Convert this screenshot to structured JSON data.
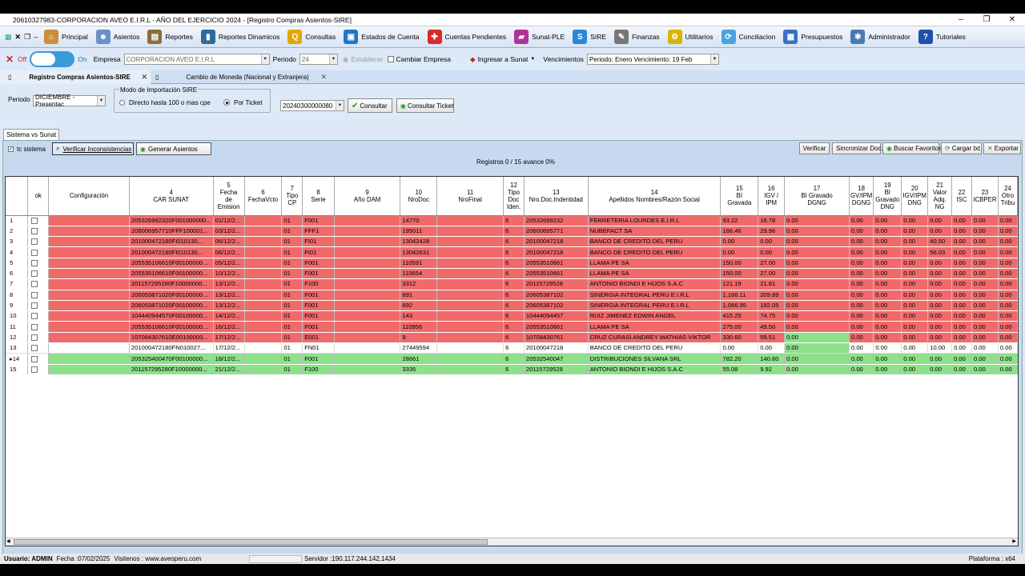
{
  "window": {
    "title": "20610327983-CORPORACION AVEO E.I.R.L  -  AÑO DEL EJERCICIO 2024 - [Registro Compras Asientos-SIRE]",
    "min": "–",
    "max": "❐",
    "close": "✕"
  },
  "menu": [
    {
      "label": "Principal",
      "icon": "home-icon",
      "color": "#c9903a",
      "glyph": "⌂"
    },
    {
      "label": "Asientos",
      "icon": "user-icon",
      "color": "#6b8fc9",
      "glyph": "☻"
    },
    {
      "label": "Reportes",
      "icon": "printer-icon",
      "color": "#8a6d3b",
      "glyph": "▤"
    },
    {
      "label": "Reportes Dinamicos",
      "icon": "chart-icon",
      "color": "#2d6a99",
      "glyph": "▮"
    },
    {
      "label": "Consultas",
      "icon": "search-icon",
      "color": "#e0a800",
      "glyph": "Q"
    },
    {
      "label": "Estados de Cuenta",
      "icon": "folder-icon",
      "color": "#1f77c9",
      "glyph": "▣"
    },
    {
      "label": "Cuentas Pendientes",
      "icon": "lifebuoy-icon",
      "color": "#d92b2b",
      "glyph": "✚"
    },
    {
      "label": "Sunat-PLE",
      "icon": "book-icon",
      "color": "#b0339a",
      "glyph": "▰"
    },
    {
      "label": "SIRE",
      "icon": "sire-icon",
      "color": "#2b87d9",
      "glyph": "S"
    },
    {
      "label": "Finanzas",
      "icon": "tools-icon",
      "color": "#777",
      "glyph": "✎"
    },
    {
      "label": "Utilitarios",
      "icon": "gear-icon",
      "color": "#d9b400",
      "glyph": "⚙"
    },
    {
      "label": "Conciliacion",
      "icon": "sync-icon",
      "color": "#4aa3df",
      "glyph": "⟳"
    },
    {
      "label": "Presupuestos",
      "icon": "calculator-icon",
      "color": "#3a6ec9",
      "glyph": "▦"
    },
    {
      "label": "Administrador",
      "icon": "cog-icon",
      "color": "#4a7ab5",
      "glyph": "✱"
    },
    {
      "label": "Tutoriales",
      "icon": "help-icon",
      "color": "#1f4fa8",
      "glyph": "?"
    }
  ],
  "toolbar": {
    "off": "Off",
    "on": "On",
    "empresa_label": "Empresa",
    "empresa_value": "CORPORACION AVEO E.I.R.L",
    "periodo_label": "Periodo",
    "periodo_value": "24",
    "establecer": "Establecer",
    "cambiar": "Cambiar Empresa",
    "ingresar": "Ingresar a Sunat",
    "vencimientos_label": "Vencimientos",
    "vencimientos_value": "Periodo: Enero Vencimiento: 19 Feb"
  },
  "tabs": [
    {
      "label": "Registro Compras Asientos-SIRE"
    },
    {
      "label": "Cambio de Moneda (Nacional y Extranjera)"
    }
  ],
  "params": {
    "periodo_label": "Periodo",
    "periodo_value": "DICIEMBRE - Presentac",
    "modo_legend": "Modo de Importación SIRE",
    "opt_directo": "Directo hasta 100 o mas cpe",
    "opt_ticket": "Por Ticket",
    "ticket_value": "20240300000080",
    "consultar": "Consultar",
    "consultar_ticket": "Consultar Ticket"
  },
  "subtab": "Sistema vs Sunat",
  "panel": {
    "tc_sistema": "tc sistema",
    "verificar_inc": "Verificar Inconsistencias",
    "generar": "Generar Asientos",
    "verificar": "Verificar",
    "sincronizar": "Sincronizar Doc.",
    "buscar_fav": "Buscar Favoritos",
    "cargar_txt": "Cargar txt",
    "exportar": "Exportar",
    "registros": "Registros 0 / 15 avance  0%"
  },
  "columns": [
    "",
    "ok",
    "Configuración",
    "4\nCAR SUNAT",
    "5\nFecha\nde\nEmision",
    "6\nFechaVcto",
    "7\nTipo\nCP",
    "8\nSerie",
    "9\nAño DAM",
    "10\nNroDoc",
    "11\nNroFinal",
    "12\nTipo\nDoc\nIden.",
    "13\nNro.Doc.Indentidad",
    "14\nApellidos Nombres/Razón Social",
    "15\nBI\nGravada",
    "16\nIGV /\nIPM",
    "17\nBI Gravado\nDGNG",
    "18\nGV/IPM\nDGNG",
    "19\nBI\nGravado\nDNG",
    "20\nIGV/IPM\nDNG",
    "21\nValor\nAdq.\nNG",
    "22\nISC",
    "23\nICBPER",
    "24\nOtro\nTribu"
  ],
  "rows": [
    {
      "n": "1",
      "s": "red",
      "d": [
        "205326992320F001000000...",
        "01/12/2...",
        "",
        "01",
        "F001",
        "",
        "14770",
        "",
        "6",
        "20532699232",
        "FERRETERIA LOURDES E.I.R.L",
        "93.22",
        "16.78",
        "0.00",
        "0.00",
        "0.00",
        "0.00",
        "0.00",
        "0.00",
        "0.00",
        "0.00"
      ]
    },
    {
      "n": "2",
      "s": "red",
      "d": [
        "206006957710FFF100001...",
        "03/12/2...",
        "",
        "01",
        "FFF1",
        "",
        "195011",
        "",
        "6",
        "20600695771",
        "NUBEFACT SA",
        "166.46",
        "29.96",
        "0.00",
        "0.00",
        "0.00",
        "0.00",
        "0.00",
        "0.00",
        "0.00",
        "0.00"
      ]
    },
    {
      "n": "3",
      "s": "red",
      "d": [
        "201000472180FI010130...",
        "06/12/2...",
        "",
        "01",
        "FI01",
        "",
        "13042428",
        "",
        "6",
        "20100047218",
        "BANCO DE CREDITO DEL PERU",
        "0.00",
        "0.00",
        "0.00",
        "0.00",
        "0.00",
        "0.00",
        "40.50",
        "0.00",
        "0.00",
        "0.00"
      ]
    },
    {
      "n": "4",
      "s": "red",
      "d": [
        "201000472180FI010130...",
        "06/12/2...",
        "",
        "01",
        "FI01",
        "",
        "13042631",
        "",
        "6",
        "20100047218",
        "BANCO DE CREDITO DEL PERU",
        "0.00",
        "0.00",
        "0.00",
        "0.00",
        "0.00",
        "0.00",
        "56.03",
        "0.00",
        "0.00",
        "0.00"
      ]
    },
    {
      "n": "5",
      "s": "red",
      "d": [
        "205535106610F00100000...",
        "05/12/2...",
        "",
        "01",
        "F001",
        "",
        "110591",
        "",
        "6",
        "20553510661",
        "LLAMA PE SA",
        "150.00",
        "27.00",
        "0.00",
        "0.00",
        "0.00",
        "0.00",
        "0.00",
        "0.00",
        "0.00",
        "0.00"
      ]
    },
    {
      "n": "6",
      "s": "red",
      "d": [
        "205535106610F00100000...",
        "10/12/2...",
        "",
        "01",
        "F001",
        "",
        "110654",
        "",
        "6",
        "20553510661",
        "LLAMA PE SA",
        "150.00",
        "27.00",
        "0.00",
        "0.00",
        "0.00",
        "0.00",
        "0.00",
        "0.00",
        "0.00",
        "0.00"
      ]
    },
    {
      "n": "7",
      "s": "red",
      "d": [
        "201157295280F10000000...",
        "13/12/2...",
        "",
        "01",
        "F100",
        "",
        "3312",
        "",
        "6",
        "20115729528",
        "ANTONIO BIONDI E HIJOS S.A.C",
        "121.19",
        "21.81",
        "0.00",
        "0.00",
        "0.00",
        "0.00",
        "0.00",
        "0.00",
        "0.00",
        "0.00"
      ]
    },
    {
      "n": "8",
      "s": "red",
      "d": [
        "206053871020F00100000...",
        "13/12/2...",
        "",
        "01",
        "F001",
        "",
        "891",
        "",
        "6",
        "20605387102",
        "SINERGIA INTEGRAL PERU E.I.R.L",
        "1,166.11",
        "209.89",
        "0.00",
        "0.00",
        "0.00",
        "0.00",
        "0.00",
        "0.00",
        "0.00",
        "0.00"
      ]
    },
    {
      "n": "9",
      "s": "red",
      "d": [
        "206053871020F00100000...",
        "13/12/2...",
        "",
        "01",
        "F001",
        "",
        "892",
        "",
        "6",
        "20605387102",
        "SINERGIA INTEGRAL PERU E.I.R.L",
        "1,066.95",
        "192.05",
        "0.00",
        "0.00",
        "0.00",
        "0.00",
        "0.00",
        "0.00",
        "0.00",
        "0.00"
      ]
    },
    {
      "n": "10",
      "s": "red",
      "d": [
        "104440944570F00100000...",
        "14/12/2...",
        "",
        "01",
        "F001",
        "",
        "143",
        "",
        "6",
        "10444094457",
        "RUIZ JIMENEZ EDWIN ANGEL",
        "415.25",
        "74.75",
        "0.00",
        "0.00",
        "0.00",
        "0.00",
        "0.00",
        "0.00",
        "0.00",
        "0.00"
      ]
    },
    {
      "n": "11",
      "s": "red",
      "d": [
        "205535106610F00100000...",
        "16/12/2...",
        "",
        "01",
        "F001",
        "",
        "110956",
        "",
        "6",
        "20553510661",
        "LLAMA PE SA",
        "275.00",
        "49.50",
        "0.00",
        "0.00",
        "0.00",
        "0.00",
        "0.00",
        "0.00",
        "0.00",
        "0.00"
      ]
    },
    {
      "n": "12",
      "s": "red",
      "d": [
        "107084307610E00100000...",
        "17/12/2...",
        "",
        "01",
        "E001",
        "",
        "9",
        "",
        "6",
        "10708430761",
        "CRUZ CURASI ANDREY MATHIAS VIKTOR",
        "330.60",
        "59.51",
        "0.00",
        "0.00",
        "0.00",
        "0.00",
        "0.00",
        "0.00",
        "0.00",
        "0.00"
      ]
    },
    {
      "n": "13",
      "s": "white",
      "d": [
        "201000472180FN010027...",
        "17/12/2...",
        "",
        "01",
        "FN01",
        "",
        "27449594",
        "",
        "6",
        "20100047218",
        "BANCO DE CREDITO DEL PERU",
        "0.00",
        "0.00",
        "0.00",
        "0.00",
        "0.00",
        "0.00",
        "10.00",
        "0.00",
        "0.00",
        "0.00"
      ]
    },
    {
      "n": "▸14",
      "s": "green",
      "d": [
        "205325400470F00100000...",
        "18/12/2...",
        "",
        "01",
        "F001",
        "",
        "28661",
        "",
        "6",
        "20532540047",
        "DISTRIBUCIONES SILVANA SRL",
        "782.20",
        "140.80",
        "0.00",
        "0.00",
        "0.00",
        "0.00",
        "0.00",
        "0.00",
        "0.00",
        "0.00"
      ]
    },
    {
      "n": "15",
      "s": "green",
      "d": [
        "201157295280F10000000...",
        "21/12/2...",
        "",
        "01",
        "F100",
        "",
        "3335",
        "",
        "6",
        "20115729528",
        "ANTONIO BIONDI E HIJOS S.A.C",
        "55.08",
        "9.92",
        "0.00",
        "0.00",
        "0.00",
        "0.00",
        "0.00",
        "0.00",
        "0.00",
        "0.00"
      ]
    }
  ],
  "status": {
    "usuario": "Usuario: ADMIN",
    "fecha": "Fecha :07/02/2025",
    "visitenos": "Visitenos : www.aveoperu.com",
    "servidor": "Servidor :190.117.244.142,1434",
    "plataforma": "Plataforma : x64"
  },
  "colors": {
    "row_red": "#f06a6a",
    "row_green": "#8fe08b",
    "accent": "#3a9bd8"
  }
}
